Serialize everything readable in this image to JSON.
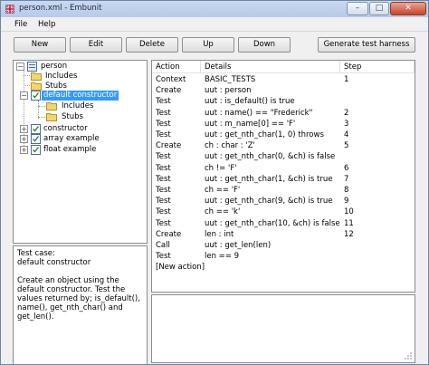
{
  "window": {
    "title": "person.xml - Embunit",
    "minimize": "–",
    "maximize": "□",
    "close": "✕"
  },
  "menu": {
    "file": "File",
    "help": "Help"
  },
  "toolbar": {
    "new": "New",
    "edit": "Edit",
    "delete": "Delete",
    "up": "Up",
    "down": "Down",
    "generate": "Generate test harness"
  },
  "tree": {
    "root": "person",
    "includes": "Includes",
    "stubs": "Stubs",
    "default_constructor": "default constructor",
    "dc_includes": "Includes",
    "dc_stubs": "Stubs",
    "constructor": "constructor",
    "array_example": "array example",
    "float_example": "float example",
    "expand_minus": "−",
    "expand_plus": "+"
  },
  "description": {
    "title_line1": "Test case:",
    "title_line2": "default constructor",
    "body": "Create an object using the default constructor. Test the values returned by; is_default(), name(), get_nth_char() and get_len()."
  },
  "table": {
    "headers": {
      "action": "Action",
      "details": "Details",
      "step": "Step"
    },
    "rows": [
      {
        "action": "Context",
        "details": "BASIC_TESTS",
        "step": "1"
      },
      {
        "action": "Create",
        "details": "uut : person",
        "step": ""
      },
      {
        "action": "Test",
        "details": "uut : is_default() is true",
        "step": ""
      },
      {
        "action": "Test",
        "details": "uut : name() == \"Frederick\"",
        "step": "2"
      },
      {
        "action": "Test",
        "details": "uut : m_name[0] == 'F'",
        "step": "3"
      },
      {
        "action": "Test",
        "details": "uut : get_nth_char(1, 0) throws",
        "step": "4"
      },
      {
        "action": "Create",
        "details": "ch : char : 'Z'",
        "step": "5"
      },
      {
        "action": "Test",
        "details": "uut : get_nth_char(0, &ch) is false",
        "step": ""
      },
      {
        "action": "Test",
        "details": "ch != 'F'",
        "step": "6"
      },
      {
        "action": "Test",
        "details": "uut : get_nth_char(1, &ch) is true",
        "step": "7"
      },
      {
        "action": "Test",
        "details": "ch == 'F'",
        "step": "8"
      },
      {
        "action": "Test",
        "details": "uut : get_nth_char(9, &ch) is true",
        "step": "9"
      },
      {
        "action": "Test",
        "details": "ch == 'k'",
        "step": "10"
      },
      {
        "action": "Test",
        "details": "uut : get_nth_char(10, &ch) is false",
        "step": "11"
      },
      {
        "action": "Create",
        "details": "len : int",
        "step": "12"
      },
      {
        "action": "Call",
        "details": "uut : get_len(len)",
        "step": ""
      },
      {
        "action": "Test",
        "details": "len == 9",
        "step": ""
      }
    ],
    "new_action": "[New action]"
  },
  "colors": {
    "selection": "#3399ff",
    "titlebar": "#b9cde7",
    "folder": "#f3d56b"
  }
}
